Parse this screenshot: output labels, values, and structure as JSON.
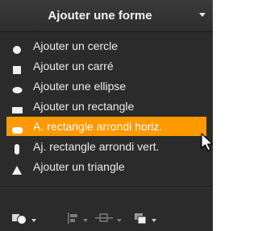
{
  "header": {
    "title": "Ajouter une forme",
    "dropdown_icon": "triangle-down-icon"
  },
  "menu": {
    "items": [
      {
        "label": "Ajouter un cercle",
        "icon": "circle-icon"
      },
      {
        "label": "Ajouter un carré",
        "icon": "square-icon"
      },
      {
        "label": "Ajouter une ellipse",
        "icon": "ellipse-icon"
      },
      {
        "label": "Ajouter un rectangle",
        "icon": "rectangle-icon"
      },
      {
        "label": "A. rectangle arrondi horiz.",
        "icon": "rounded-rect-horizontal-icon",
        "highlighted": true
      },
      {
        "label": "Aj. rectangle arrondi vert.",
        "icon": "rounded-rect-vertical-icon"
      },
      {
        "label": "Ajouter un triangle",
        "icon": "triangle-icon"
      }
    ]
  },
  "toolbar": {
    "tools": [
      {
        "icon": "shapes-icon",
        "state": "enabled"
      },
      {
        "icon": "align-icon",
        "state": "disabled"
      },
      {
        "icon": "distribute-icon",
        "state": "disabled"
      },
      {
        "icon": "arrange-icon",
        "state": "enabled"
      }
    ]
  },
  "colors": {
    "panel_background": "#2b2b2b",
    "highlight": "#ff9900",
    "text": "#ededed"
  }
}
